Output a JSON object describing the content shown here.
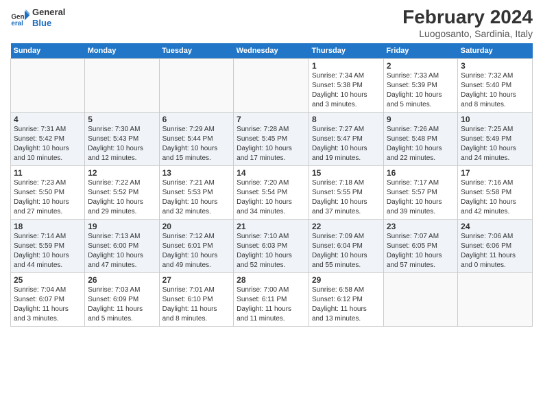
{
  "logo": {
    "general": "General",
    "blue": "Blue"
  },
  "title": "February 2024",
  "subtitle": "Luogosanto, Sardinia, Italy",
  "days_header": [
    "Sunday",
    "Monday",
    "Tuesday",
    "Wednesday",
    "Thursday",
    "Friday",
    "Saturday"
  ],
  "weeks": [
    [
      {
        "day": "",
        "info": ""
      },
      {
        "day": "",
        "info": ""
      },
      {
        "day": "",
        "info": ""
      },
      {
        "day": "",
        "info": ""
      },
      {
        "day": "1",
        "info": "Sunrise: 7:34 AM\nSunset: 5:38 PM\nDaylight: 10 hours\nand 3 minutes."
      },
      {
        "day": "2",
        "info": "Sunrise: 7:33 AM\nSunset: 5:39 PM\nDaylight: 10 hours\nand 5 minutes."
      },
      {
        "day": "3",
        "info": "Sunrise: 7:32 AM\nSunset: 5:40 PM\nDaylight: 10 hours\nand 8 minutes."
      }
    ],
    [
      {
        "day": "4",
        "info": "Sunrise: 7:31 AM\nSunset: 5:42 PM\nDaylight: 10 hours\nand 10 minutes."
      },
      {
        "day": "5",
        "info": "Sunrise: 7:30 AM\nSunset: 5:43 PM\nDaylight: 10 hours\nand 12 minutes."
      },
      {
        "day": "6",
        "info": "Sunrise: 7:29 AM\nSunset: 5:44 PM\nDaylight: 10 hours\nand 15 minutes."
      },
      {
        "day": "7",
        "info": "Sunrise: 7:28 AM\nSunset: 5:45 PM\nDaylight: 10 hours\nand 17 minutes."
      },
      {
        "day": "8",
        "info": "Sunrise: 7:27 AM\nSunset: 5:47 PM\nDaylight: 10 hours\nand 19 minutes."
      },
      {
        "day": "9",
        "info": "Sunrise: 7:26 AM\nSunset: 5:48 PM\nDaylight: 10 hours\nand 22 minutes."
      },
      {
        "day": "10",
        "info": "Sunrise: 7:25 AM\nSunset: 5:49 PM\nDaylight: 10 hours\nand 24 minutes."
      }
    ],
    [
      {
        "day": "11",
        "info": "Sunrise: 7:23 AM\nSunset: 5:50 PM\nDaylight: 10 hours\nand 27 minutes."
      },
      {
        "day": "12",
        "info": "Sunrise: 7:22 AM\nSunset: 5:52 PM\nDaylight: 10 hours\nand 29 minutes."
      },
      {
        "day": "13",
        "info": "Sunrise: 7:21 AM\nSunset: 5:53 PM\nDaylight: 10 hours\nand 32 minutes."
      },
      {
        "day": "14",
        "info": "Sunrise: 7:20 AM\nSunset: 5:54 PM\nDaylight: 10 hours\nand 34 minutes."
      },
      {
        "day": "15",
        "info": "Sunrise: 7:18 AM\nSunset: 5:55 PM\nDaylight: 10 hours\nand 37 minutes."
      },
      {
        "day": "16",
        "info": "Sunrise: 7:17 AM\nSunset: 5:57 PM\nDaylight: 10 hours\nand 39 minutes."
      },
      {
        "day": "17",
        "info": "Sunrise: 7:16 AM\nSunset: 5:58 PM\nDaylight: 10 hours\nand 42 minutes."
      }
    ],
    [
      {
        "day": "18",
        "info": "Sunrise: 7:14 AM\nSunset: 5:59 PM\nDaylight: 10 hours\nand 44 minutes."
      },
      {
        "day": "19",
        "info": "Sunrise: 7:13 AM\nSunset: 6:00 PM\nDaylight: 10 hours\nand 47 minutes."
      },
      {
        "day": "20",
        "info": "Sunrise: 7:12 AM\nSunset: 6:01 PM\nDaylight: 10 hours\nand 49 minutes."
      },
      {
        "day": "21",
        "info": "Sunrise: 7:10 AM\nSunset: 6:03 PM\nDaylight: 10 hours\nand 52 minutes."
      },
      {
        "day": "22",
        "info": "Sunrise: 7:09 AM\nSunset: 6:04 PM\nDaylight: 10 hours\nand 55 minutes."
      },
      {
        "day": "23",
        "info": "Sunrise: 7:07 AM\nSunset: 6:05 PM\nDaylight: 10 hours\nand 57 minutes."
      },
      {
        "day": "24",
        "info": "Sunrise: 7:06 AM\nSunset: 6:06 PM\nDaylight: 11 hours\nand 0 minutes."
      }
    ],
    [
      {
        "day": "25",
        "info": "Sunrise: 7:04 AM\nSunset: 6:07 PM\nDaylight: 11 hours\nand 3 minutes."
      },
      {
        "day": "26",
        "info": "Sunrise: 7:03 AM\nSunset: 6:09 PM\nDaylight: 11 hours\nand 5 minutes."
      },
      {
        "day": "27",
        "info": "Sunrise: 7:01 AM\nSunset: 6:10 PM\nDaylight: 11 hours\nand 8 minutes."
      },
      {
        "day": "28",
        "info": "Sunrise: 7:00 AM\nSunset: 6:11 PM\nDaylight: 11 hours\nand 11 minutes."
      },
      {
        "day": "29",
        "info": "Sunrise: 6:58 AM\nSunset: 6:12 PM\nDaylight: 11 hours\nand 13 minutes."
      },
      {
        "day": "",
        "info": ""
      },
      {
        "day": "",
        "info": ""
      }
    ]
  ]
}
